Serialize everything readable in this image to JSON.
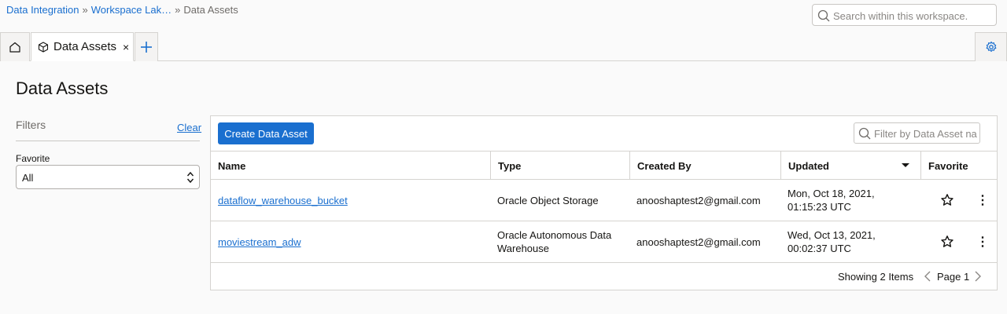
{
  "breadcrumb": {
    "items": [
      "Data Integration",
      "Workspace Lak…",
      "Data Assets"
    ],
    "separator": "»"
  },
  "header": {
    "search_placeholder": "Search within this workspace."
  },
  "tabs": {
    "active_label": "Data Assets",
    "close_glyph": "×",
    "add_glyph": "+"
  },
  "page": {
    "title": "Data Assets"
  },
  "filters": {
    "label": "Filters",
    "clear_label": "Clear",
    "favorite_label": "Favorite",
    "favorite_value": "All"
  },
  "table": {
    "create_button": "Create Data Asset",
    "filter_placeholder": "Filter by Data Asset na",
    "columns": [
      "Name",
      "Type",
      "Created By",
      "Updated",
      "Favorite"
    ],
    "rows": [
      {
        "name": "dataflow_warehouse_bucket",
        "type": "Oracle Object Storage",
        "created_by": "anooshaptest2@gmail.com",
        "updated_line1": "Mon, Oct 18, 2021,",
        "updated_line2": "01:15:23 UTC",
        "kebab": "⋮"
      },
      {
        "name": "moviestream_adw",
        "type_line1": "Oracle Autonomous Data",
        "type_line2": "Warehouse",
        "created_by": "anooshaptest2@gmail.com",
        "updated_line1": "Wed, Oct 13, 2021,",
        "updated_line2": "00:02:37 UTC",
        "kebab": "⋮"
      }
    ],
    "footer": {
      "showing": "Showing 2 Items",
      "page": "Page 1"
    }
  },
  "colors": {
    "accent": "#1a6fcf",
    "border": "#d5d3d0",
    "background": "#fafafa"
  },
  "icons": [
    "search-icon",
    "home-icon",
    "cube-icon",
    "close-icon",
    "plus-icon",
    "gear-icon",
    "updown-icon",
    "star-icon",
    "kebab-icon",
    "chevron-left-icon",
    "chevron-right-icon"
  ]
}
